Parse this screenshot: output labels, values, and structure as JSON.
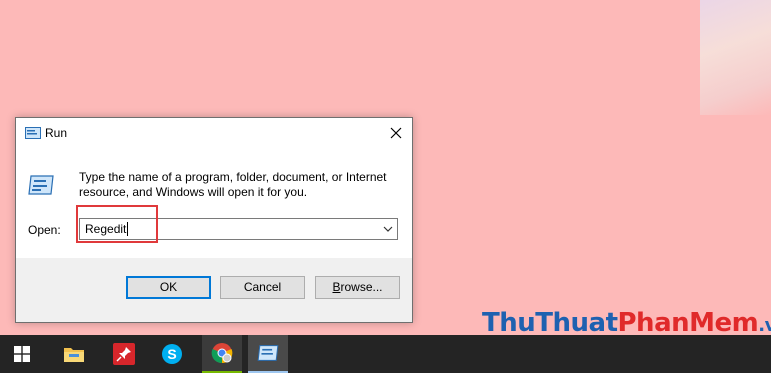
{
  "dialog": {
    "title": "Run",
    "description": "Type the name of a program, folder, document, or Internet resource, and Windows will open it for you.",
    "open_label": "Open:",
    "open_value": "Regedit",
    "ok_label": "OK",
    "cancel_label": "Cancel",
    "browse_label_underlined": "B",
    "browse_label_rest": "rowse...",
    "icons": {
      "title": "run-icon",
      "body": "run-icon",
      "close": "close-icon",
      "dropdown": "chevron-down-icon"
    }
  },
  "taskbar": {
    "items": [
      "windows-start-icon",
      "file-explorer-icon",
      "pinned-app-icon",
      "skype-icon",
      "chrome-icon",
      "run-icon"
    ]
  },
  "watermark": {
    "part1": "Thu",
    "part2": "Thuat",
    "part3": "Phan",
    "part4": "Mem",
    "part5": ".vn"
  },
  "colors": {
    "desktop": "#fdb9b8",
    "highlight": "#e0393b",
    "accent": "#0078d7",
    "taskbar": "#242424"
  }
}
